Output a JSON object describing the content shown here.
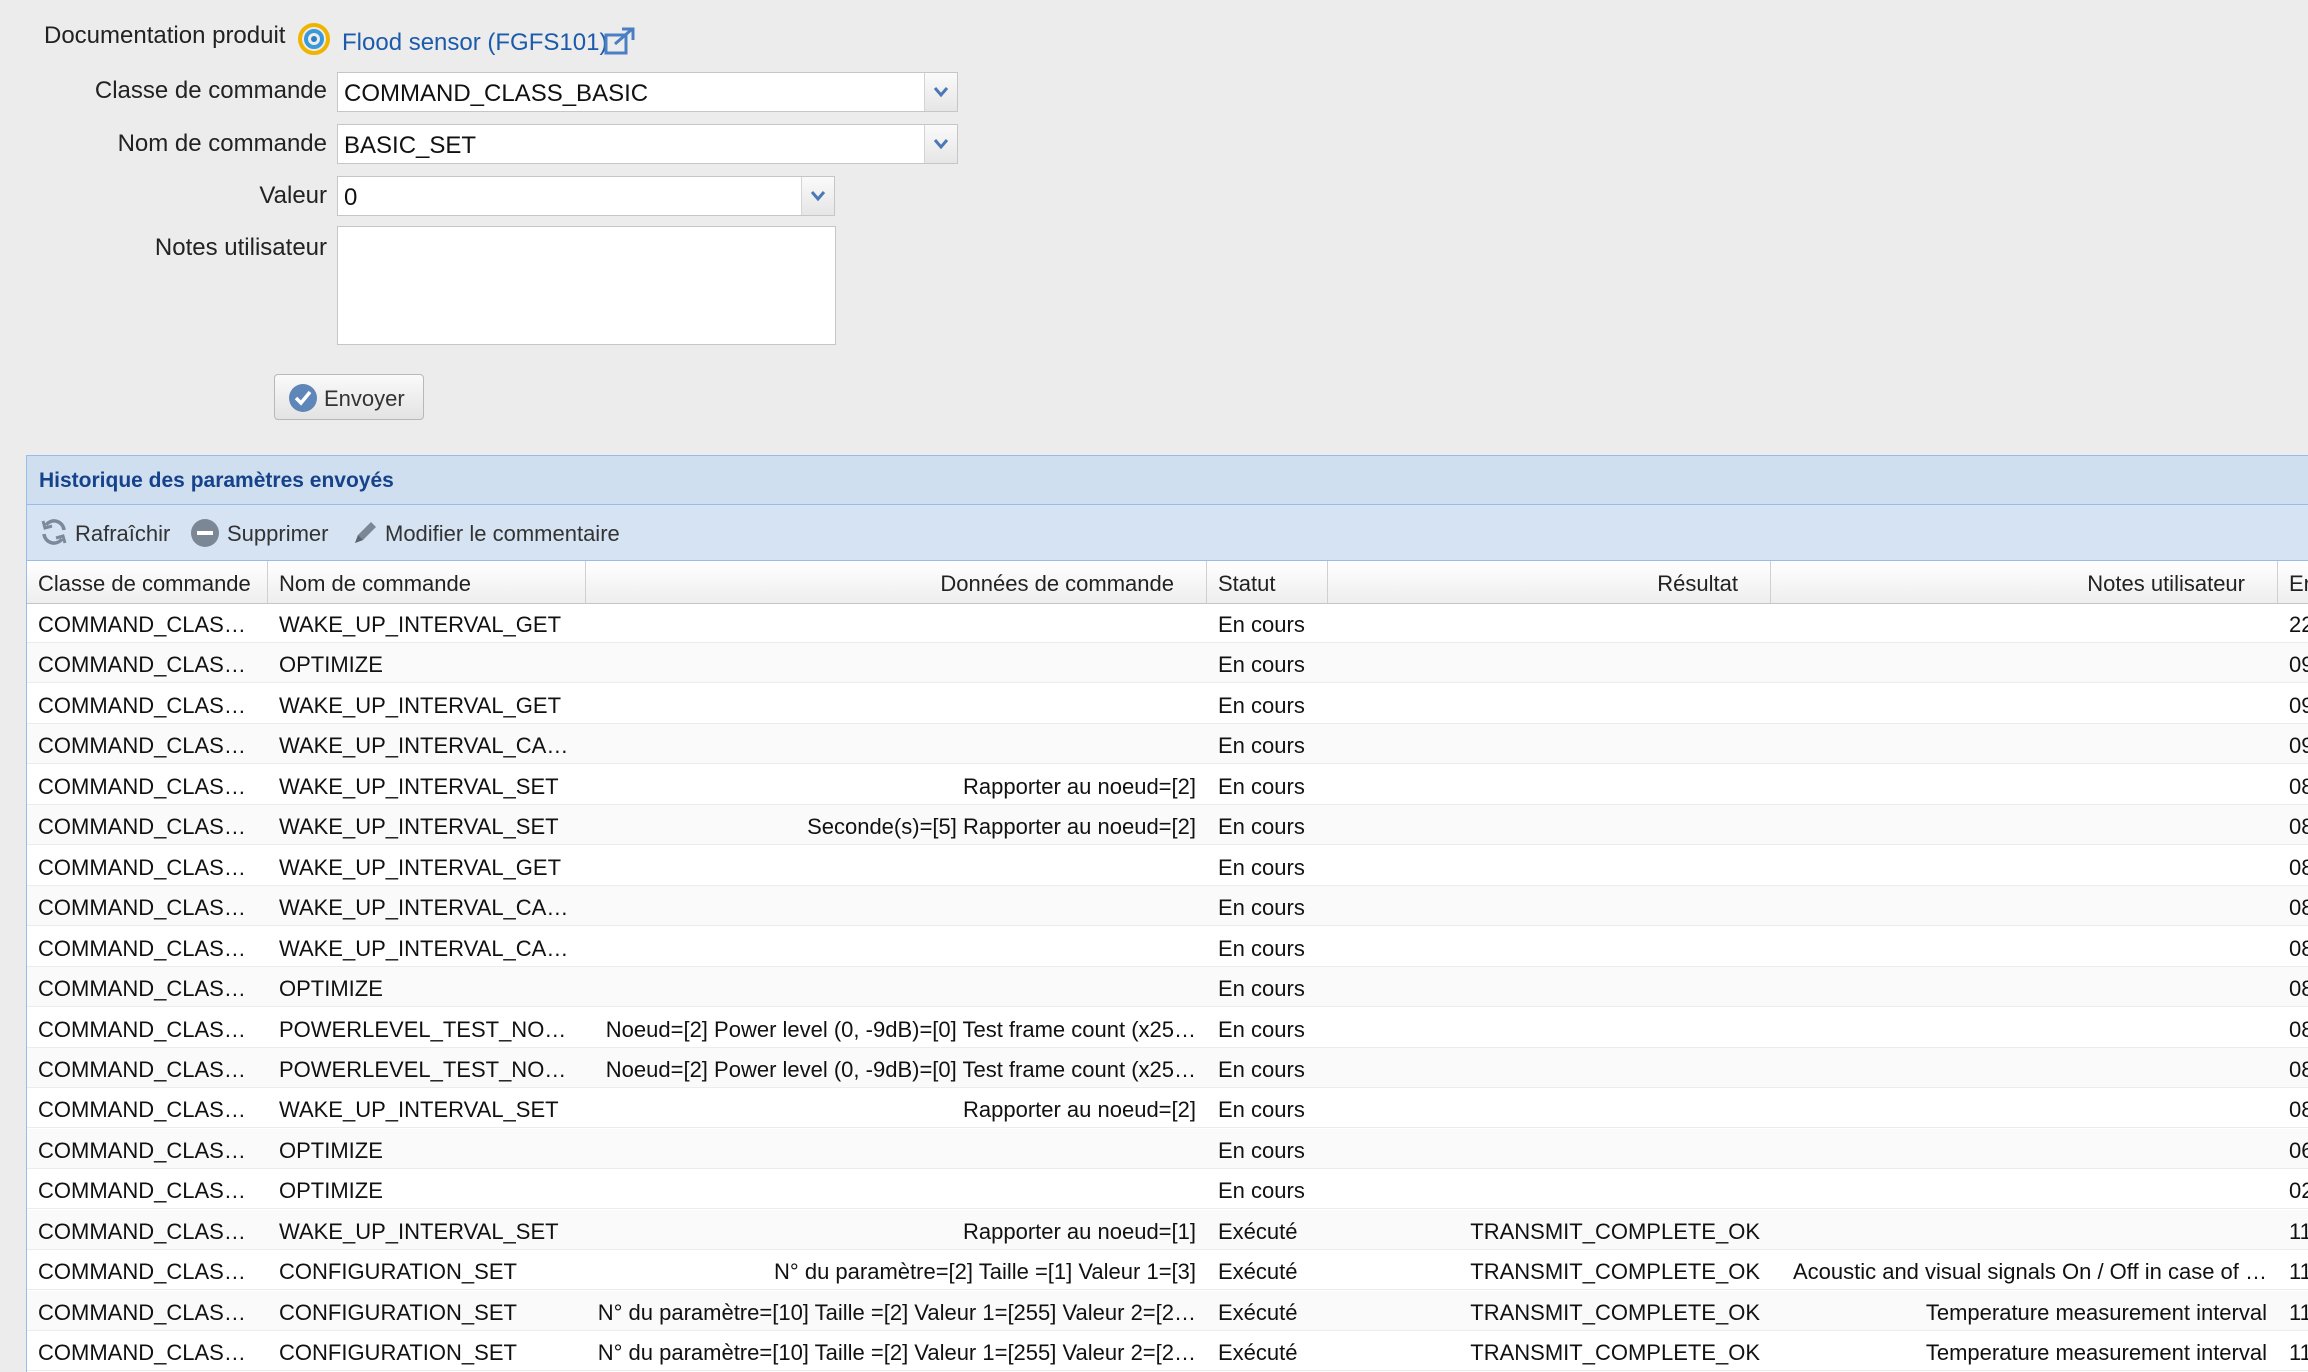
{
  "form": {
    "doc_label": "Documentation produit",
    "doc_link": "Flood sensor (FGFS101)",
    "class_label": "Classe de commande",
    "class_value": "COMMAND_CLASS_BASIC",
    "name_label": "Nom de commande",
    "name_value": "BASIC_SET",
    "value_label": "Valeur",
    "value_value": "0",
    "notes_label": "Notes utilisateur",
    "notes_value": "",
    "send_label": "Envoyer"
  },
  "panel": {
    "title": "Historique des paramètres envoyés",
    "toolbar": {
      "refresh": "Rafraîchir",
      "delete": "Supprimer",
      "edit_comment": "Modifier le commentaire"
    }
  },
  "grid": {
    "columns": [
      "Classe de commande",
      "Nom de commande",
      "Données de commande",
      "Statut",
      "Résultat",
      "Notes utilisateur",
      "En"
    ],
    "rows": [
      {
        "cls": "COMMAND_CLASS…",
        "name": "WAKE_UP_INTERVAL_GET",
        "data": "",
        "status": "En cours",
        "result": "",
        "notes": "",
        "date": "22/"
      },
      {
        "cls": "COMMAND_CLASS…",
        "name": "OPTIMIZE",
        "data": "",
        "status": "En cours",
        "result": "",
        "notes": "",
        "date": "09/"
      },
      {
        "cls": "COMMAND_CLASS…",
        "name": "WAKE_UP_INTERVAL_GET",
        "data": "",
        "status": "En cours",
        "result": "",
        "notes": "",
        "date": "09/"
      },
      {
        "cls": "COMMAND_CLASS…",
        "name": "WAKE_UP_INTERVAL_CA…",
        "data": "",
        "status": "En cours",
        "result": "",
        "notes": "",
        "date": "09/"
      },
      {
        "cls": "COMMAND_CLASS…",
        "name": "WAKE_UP_INTERVAL_SET",
        "data": "Rapporter au noeud=[2]",
        "status": "En cours",
        "result": "",
        "notes": "",
        "date": "08/"
      },
      {
        "cls": "COMMAND_CLASS…",
        "name": "WAKE_UP_INTERVAL_SET",
        "data": "Seconde(s)=[5] Rapporter au noeud=[2]",
        "status": "En cours",
        "result": "",
        "notes": "",
        "date": "08/"
      },
      {
        "cls": "COMMAND_CLASS…",
        "name": "WAKE_UP_INTERVAL_GET",
        "data": "",
        "status": "En cours",
        "result": "",
        "notes": "",
        "date": "08/"
      },
      {
        "cls": "COMMAND_CLASS…",
        "name": "WAKE_UP_INTERVAL_CA…",
        "data": "",
        "status": "En cours",
        "result": "",
        "notes": "",
        "date": "08/"
      },
      {
        "cls": "COMMAND_CLASS…",
        "name": "WAKE_UP_INTERVAL_CA…",
        "data": "",
        "status": "En cours",
        "result": "",
        "notes": "",
        "date": "08/"
      },
      {
        "cls": "COMMAND_CLASS…",
        "name": "OPTIMIZE",
        "data": "",
        "status": "En cours",
        "result": "",
        "notes": "",
        "date": "08/"
      },
      {
        "cls": "COMMAND_CLASS…",
        "name": "POWERLEVEL_TEST_NO…",
        "data": "Noeud=[2] Power level (0, -9dB)=[0] Test frame count (x25…",
        "status": "En cours",
        "result": "",
        "notes": "",
        "date": "08/"
      },
      {
        "cls": "COMMAND_CLASS…",
        "name": "POWERLEVEL_TEST_NO…",
        "data": "Noeud=[2] Power level (0, -9dB)=[0] Test frame count (x25…",
        "status": "En cours",
        "result": "",
        "notes": "",
        "date": "08/"
      },
      {
        "cls": "COMMAND_CLASS…",
        "name": "WAKE_UP_INTERVAL_SET",
        "data": "Rapporter au noeud=[2]",
        "status": "En cours",
        "result": "",
        "notes": "",
        "date": "08/"
      },
      {
        "cls": "COMMAND_CLASS…",
        "name": "OPTIMIZE",
        "data": "",
        "status": "En cours",
        "result": "",
        "notes": "",
        "date": "06/"
      },
      {
        "cls": "COMMAND_CLASS…",
        "name": "OPTIMIZE",
        "data": "",
        "status": "En cours",
        "result": "",
        "notes": "",
        "date": "02/"
      },
      {
        "cls": "COMMAND_CLASS…",
        "name": "WAKE_UP_INTERVAL_SET",
        "data": "Rapporter au noeud=[1]",
        "status": "Exécuté",
        "result": "TRANSMIT_COMPLETE_OK",
        "notes": "",
        "date": "11/"
      },
      {
        "cls": "COMMAND_CLASS…",
        "name": "CONFIGURATION_SET",
        "data": "N° du paramètre=[2] Taille =[1] Valeur 1=[3]",
        "status": "Exécuté",
        "result": "TRANSMIT_COMPLETE_OK",
        "notes": "Acoustic and visual signals On / Off in case of …",
        "date": "11/"
      },
      {
        "cls": "COMMAND_CLASS…",
        "name": "CONFIGURATION_SET",
        "data": "N° du paramètre=[10] Taille =[2] Valeur 1=[255] Valeur 2=[2…",
        "status": "Exécuté",
        "result": "TRANSMIT_COMPLETE_OK",
        "notes": "Temperature measurement interval",
        "date": "11/"
      },
      {
        "cls": "COMMAND_CLASS…",
        "name": "CONFIGURATION_SET",
        "data": "N° du paramètre=[10] Taille =[2] Valeur 1=[255] Valeur 2=[2…",
        "status": "Exécuté",
        "result": "TRANSMIT_COMPLETE_OK",
        "notes": "Temperature measurement interval",
        "date": "11/"
      }
    ]
  }
}
